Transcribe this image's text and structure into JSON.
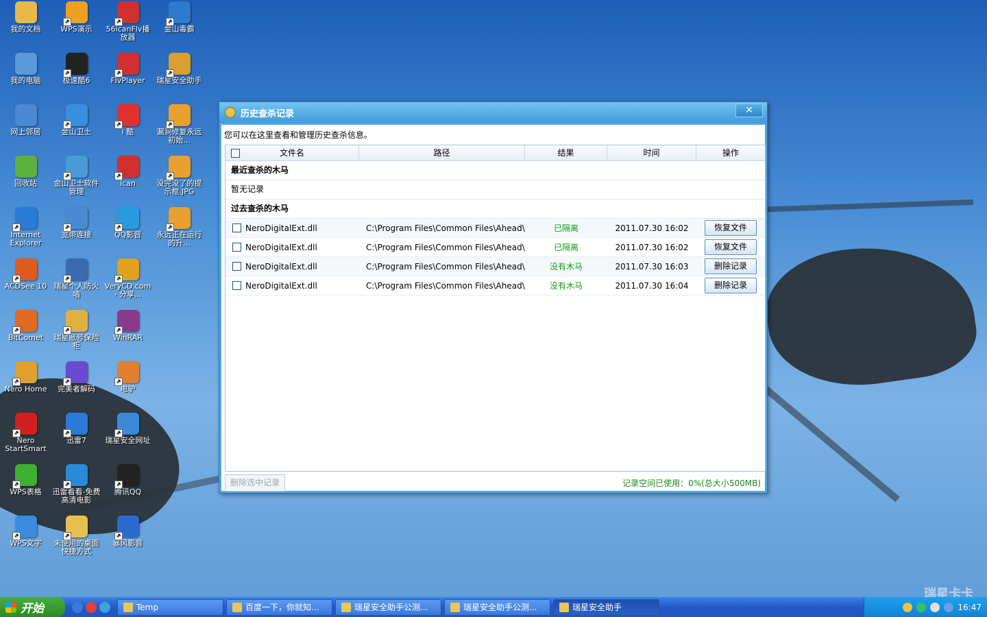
{
  "desktop": {
    "icons": [
      {
        "label": "我的文档",
        "color": "#e8b84a"
      },
      {
        "label": "WPS演示",
        "color": "#f0a020"
      },
      {
        "label": "56icanFlv播放器",
        "color": "#d23030"
      },
      {
        "label": "金山毒霸",
        "color": "#2d7ad0"
      },
      {
        "label": "我的电脑",
        "color": "#5a9ad8"
      },
      {
        "label": "极速酷6",
        "color": "#222222"
      },
      {
        "label": "FlvPlayer",
        "color": "#d23030"
      },
      {
        "label": "瑞星安全助手",
        "color": "#d8a030"
      },
      {
        "label": "网上邻居",
        "color": "#4a8ad0"
      },
      {
        "label": "金山卫士",
        "color": "#3a8ee0"
      },
      {
        "label": "i 酷",
        "color": "#e03030"
      },
      {
        "label": "漏洞修复永远初始...",
        "color": "#e8a030"
      },
      {
        "label": "回收站",
        "color": "#60b040"
      },
      {
        "label": "金山卫士软件管理",
        "color": "#4a9ad8"
      },
      {
        "label": "ican",
        "color": "#d23030"
      },
      {
        "label": "没完没了的提示框.JPG",
        "color": "#e8a030"
      },
      {
        "label": "Internet Explorer",
        "color": "#2a7ad8"
      },
      {
        "label": "宽带连接",
        "color": "#4a8ad0"
      },
      {
        "label": "QQ影音",
        "color": "#2a9ae0"
      },
      {
        "label": "永远正在运行的升...",
        "color": "#e8a030"
      },
      {
        "label": "ACDSee 10",
        "color": "#e05a20"
      },
      {
        "label": "瑞星个人防火墙",
        "color": "#3a6ab0"
      },
      {
        "label": "VeryCD.com - 分享...",
        "color": "#e0a020"
      },
      {
        "label": "BitComet",
        "color": "#e06a20"
      },
      {
        "label": "瑞星账号保险柜",
        "color": "#e0b040"
      },
      {
        "label": "WinRAR",
        "color": "#8a3a8a"
      },
      {
        "label": "Nero Home",
        "color": "#e0a030"
      },
      {
        "label": "完美者解码",
        "color": "#6a4ad0"
      },
      {
        "label": "电驴",
        "color": "#e08030"
      },
      {
        "label": "Nero StartSmart",
        "color": "#d02020"
      },
      {
        "label": "迅雷7",
        "color": "#2a7ad8"
      },
      {
        "label": "瑞星安全网址",
        "color": "#3a8ad8"
      },
      {
        "label": "WPS表格",
        "color": "#40b030"
      },
      {
        "label": "迅雷看看-免费高清电影",
        "color": "#2a8ad8"
      },
      {
        "label": "腾讯QQ",
        "color": "#222222"
      },
      {
        "label": "WPS文字",
        "color": "#3a8ae0"
      },
      {
        "label": "未使用的桌面快捷方式",
        "color": "#e8c050"
      },
      {
        "label": "暴风影音",
        "color": "#2a6ad0"
      }
    ]
  },
  "dialog": {
    "title": "历史查杀记录",
    "close_label": "✕",
    "intro": "您可以在这里查看和管理历史查杀信息。",
    "columns": {
      "name": "文件名",
      "path": "路径",
      "result": "结果",
      "time": "时间",
      "op": "操作"
    },
    "recent_section": "最近查杀的木马",
    "recent_empty": "暂无记录",
    "past_section": "过去查杀的木马",
    "rows": [
      {
        "name": "NeroDigitalExt.dll",
        "path": "C:\\Program Files\\Common Files\\Ahead\\...",
        "result": "已隔离",
        "time": "2011.07.30 16:02",
        "action": "恢复文件"
      },
      {
        "name": "NeroDigitalExt.dll",
        "path": "C:\\Program Files\\Common Files\\Ahead\\...",
        "result": "已隔离",
        "time": "2011.07.30 16:02",
        "action": "恢复文件"
      },
      {
        "name": "NeroDigitalExt.dll",
        "path": "C:\\Program Files\\Common Files\\Ahead\\...",
        "result": "没有木马",
        "time": "2011.07.30 16:03",
        "action": "删除记录"
      },
      {
        "name": "NeroDigitalExt.dll",
        "path": "C:\\Program Files\\Common Files\\Ahead\\...",
        "result": "没有木马",
        "time": "2011.07.30 16:04",
        "action": "删除记录"
      }
    ],
    "delete_selected": "删除选中记录",
    "usage": "记录空间已使用：0%(总大小500MB)"
  },
  "taskbar": {
    "start": "开始",
    "tasks": [
      {
        "label": "Temp"
      },
      {
        "label": "百度一下，你就知..."
      },
      {
        "label": "瑞星安全助手公测..."
      },
      {
        "label": "瑞星安全助手公测..."
      },
      {
        "label": "瑞星安全助手"
      }
    ],
    "clock": "16:47"
  },
  "watermark": "瑞星卡卡"
}
